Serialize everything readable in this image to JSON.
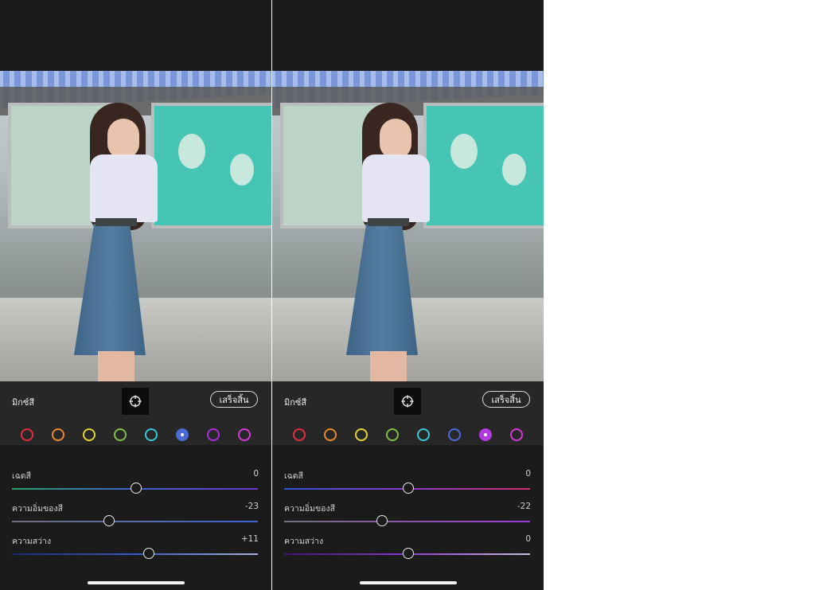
{
  "panels": [
    {
      "id": "left",
      "title": "มิกซ์สี",
      "done_label": "เสร็จสิ้น",
      "target_icon": "target-adjust-icon",
      "swatches": [
        {
          "color": "#e0303f",
          "selected": false
        },
        {
          "color": "#e88a2b",
          "selected": false
        },
        {
          "color": "#e4d43a",
          "selected": false
        },
        {
          "color": "#7fbf47",
          "selected": false
        },
        {
          "color": "#3ac7d8",
          "selected": false
        },
        {
          "color": "#4a6ad6",
          "selected": true
        },
        {
          "color": "#a930d9",
          "selected": false
        },
        {
          "color": "#d23ad0",
          "selected": false
        }
      ],
      "sliders": [
        {
          "label": "เฉดสี",
          "value": "0",
          "fraction": 0.5,
          "track": "linear-gradient(90deg,#2aa36a,#3f5fcf 50%,#6a3ad0)"
        },
        {
          "label": "ความอิ่มของสี",
          "value": "-23",
          "fraction": 0.39,
          "track": "linear-gradient(90deg,#6f6f78,#3f63d6)"
        },
        {
          "label": "ความสว่าง",
          "value": "+11",
          "fraction": 0.555,
          "track": "linear-gradient(90deg,#1f2a6a,#3d56c2 50%,#a9b3d6)"
        }
      ]
    },
    {
      "id": "right",
      "title": "มิกซ์สี",
      "done_label": "เสร็จสิ้น",
      "target_icon": "target-adjust-icon",
      "swatches": [
        {
          "color": "#e0303f",
          "selected": false
        },
        {
          "color": "#e88a2b",
          "selected": false
        },
        {
          "color": "#e4d43a",
          "selected": false
        },
        {
          "color": "#7fbf47",
          "selected": false
        },
        {
          "color": "#3ac7d8",
          "selected": false
        },
        {
          "color": "#4a6ad6",
          "selected": false
        },
        {
          "color": "#b23ae0",
          "selected": true
        },
        {
          "color": "#d23ad0",
          "selected": false
        }
      ],
      "sliders": [
        {
          "label": "เฉดสี",
          "value": "0",
          "fraction": 0.5,
          "track": "linear-gradient(90deg,#3355d6,#8a3ad0 50%,#d0306f)"
        },
        {
          "label": "ความอิ่มของสี",
          "value": "-22",
          "fraction": 0.395,
          "track": "linear-gradient(90deg,#74727a,#9b3ad8)"
        },
        {
          "label": "ความสว่าง",
          "value": "0",
          "fraction": 0.5,
          "track": "linear-gradient(90deg,#3a1a6a,#8a3ad0 50%,#c9bfd6)"
        }
      ]
    }
  ]
}
